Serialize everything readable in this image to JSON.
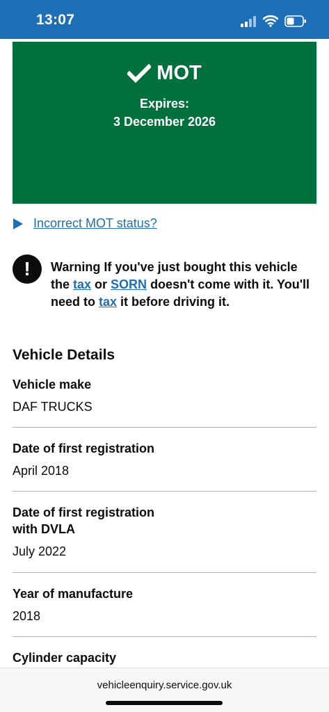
{
  "status_bar": {
    "time": "13:07"
  },
  "mot_panel": {
    "title": "MOT",
    "expires_label": "Expires:",
    "expires_date": "3 December 2026",
    "color": "#00703c"
  },
  "incorrect_link": "Incorrect MOT status?",
  "warning": {
    "prefix": "Warning If you've just bought this vehicle the ",
    "link_tax_1": "tax",
    "or": " or ",
    "link_sorn": "SORN",
    "middle": " doesn't come with it. You'll need to ",
    "link_tax_2": "tax",
    "suffix": " it before driving it."
  },
  "vehicle_details": {
    "heading": "Vehicle Details",
    "rows": [
      {
        "label": "Vehicle make",
        "value": "DAF TRUCKS"
      },
      {
        "label": "Date of first registration",
        "value": "April 2018"
      },
      {
        "label": "Date of first registration with DVLA",
        "value": "July 2022"
      },
      {
        "label": "Year of manufacture",
        "value": "2018"
      },
      {
        "label": "Cylinder capacity",
        "value": ""
      }
    ]
  },
  "browser": {
    "url": "vehicleenquiry.service.gov.uk"
  },
  "colors": {
    "header_blue": "#1d70b8",
    "link_blue": "#1d70b8",
    "success_green": "#00703c",
    "text_black": "#0b0c0c"
  }
}
